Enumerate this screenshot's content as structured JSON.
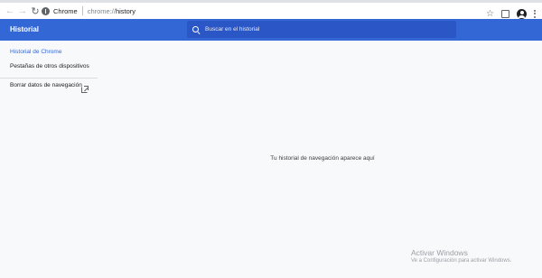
{
  "toolbar": {
    "back_glyph": "←",
    "forward_glyph": "→",
    "reload_glyph": "↻",
    "chip_label": "Chrome",
    "url_scheme": "chrome://",
    "url_path": "history",
    "star_glyph": "☆"
  },
  "header": {
    "title": "Historial",
    "search_placeholder": "Buscar en el historial"
  },
  "sidebar": {
    "history_label": "Historial de Chrome",
    "other_devices_label": "Pestañas de otros dispositivos",
    "clear_data_label": "Borrar datos de navegación"
  },
  "main": {
    "empty_message": "Tu historial de navegación aparece aquí"
  },
  "watermark": {
    "title": "Activar Windows",
    "subtitle": "Ve a Configuración para activar Windows."
  },
  "colors": {
    "accent": "#3367d6",
    "search_bg": "#2a56c6",
    "page_bg": "#f8f9fa"
  }
}
